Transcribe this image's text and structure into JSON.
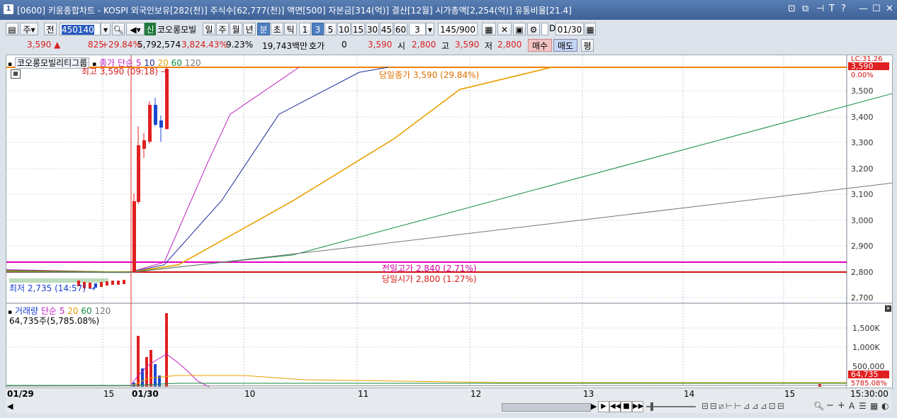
{
  "window": {
    "number": "1",
    "title": "[0600] 키움종합차트 - KOSPI 외국인보유[282(천)] 주식수[62,777(천)] 액면[500] 자본금[314(억)] 결산[12월] 시가총액[2,254(억)] 유통비율[21.4]"
  },
  "toolbar": {
    "market": "주",
    "prev": "전",
    "code": "450140",
    "sin_badge": "신",
    "stock_name": "코오롱모빌",
    "period_tabs": [
      "일",
      "주",
      "월",
      "년",
      "분",
      "초",
      "틱"
    ],
    "selected_period": "분",
    "interval_buttons": [
      "1",
      "3",
      "5",
      "10",
      "15",
      "30",
      "45",
      "60"
    ],
    "selected_interval": "3",
    "interval_value": "3",
    "count": "145",
    "count_max": "/900",
    "checkbox_label": "D",
    "date": "01/30"
  },
  "quote": {
    "price": "3,590",
    "change": "825",
    "change_pct": "+29.84%",
    "volume": "5,792,574",
    "volume_ratio": "3,824.43%",
    "turnover": "9.23%",
    "amount": "19,743백만",
    "hoga_label": "호가",
    "hoga_value": "0",
    "hoga_price": "3,590",
    "open_label": "시",
    "open": "2,800",
    "high_label": "고",
    "high": "3,590",
    "low_label": "저",
    "low": "2,800",
    "buy_label": "매수",
    "sell_label": "매도",
    "flat_label": "평"
  },
  "main_legend": {
    "name": "코오롱모빌리티그룹",
    "ma_label": "종가 단순",
    "periods": [
      "5",
      "10",
      "20",
      "60",
      "120"
    ],
    "period_colors": [
      "#c020c0",
      "#1a2a9a",
      "#e8a000",
      "#108a40",
      "#777777"
    ]
  },
  "annotations": {
    "high_marker": "최고 3,590 (09:18) →",
    "low_marker": "최저 2,735 (14:57) →",
    "today_close": "당일종가 3,590 (29.84%)",
    "prev_high": "전일고가 2,840 (2.71%)",
    "today_open": "당일시가 2,800 (1.27%)",
    "lc_label": "LC:31.26",
    "price_badge": "3,590",
    "pct_badge": "0.00%"
  },
  "price_axis": [
    "3,500",
    "3,400",
    "3,300",
    "3,200",
    "3,100",
    "3,000",
    "2,900",
    "2,800",
    "2,700"
  ],
  "volume_legend": {
    "label": "거래량",
    "ma_label": "단순",
    "periods": [
      "5",
      "20",
      "60",
      "120"
    ],
    "volume_value": "64,735주(5,785.08%)"
  },
  "volume_axis": [
    "1,500K",
    "1,000K",
    "500,000"
  ],
  "volume_badges": {
    "value": "64,735",
    "pct": "5785.08%"
  },
  "date_axis": {
    "labels": [
      "01/29",
      "15",
      "01/30",
      "10",
      "11",
      "12",
      "13",
      "14",
      "15"
    ],
    "time": "15:30:00"
  },
  "colors": {
    "candle_up": "#e02020",
    "candle_down": "#1a4ad0",
    "close_line": "#f08000",
    "prev_high_line": "#e800c0",
    "open_line": "#d01010"
  },
  "chart_data": {
    "type": "line",
    "ylim": [
      2700,
      3590
    ],
    "series": [
      {
        "name": "5",
        "color": "#c020c0",
        "points": [
          [
            0,
            2770
          ],
          [
            0.43,
            2760
          ],
          [
            0.55,
            2800
          ],
          [
            0.7,
            3200
          ],
          [
            0.78,
            3400
          ],
          [
            1.02,
            3590
          ]
        ]
      },
      {
        "name": "10",
        "color": "#1a2a9a",
        "points": [
          [
            0,
            2768
          ],
          [
            0.43,
            2760
          ],
          [
            0.55,
            2790
          ],
          [
            0.75,
            3050
          ],
          [
            0.95,
            3400
          ],
          [
            1.23,
            3570
          ],
          [
            1.33,
            3590
          ]
        ]
      },
      {
        "name": "20",
        "color": "#e8a000",
        "points": [
          [
            0,
            2765
          ],
          [
            0.43,
            2760
          ],
          [
            0.6,
            2790
          ],
          [
            1.0,
            3050
          ],
          [
            1.35,
            3300
          ],
          [
            1.58,
            3500
          ],
          [
            1.9,
            3590
          ]
        ]
      },
      {
        "name": "60",
        "color": "#108a40",
        "points": [
          [
            0,
            2762
          ],
          [
            0.43,
            2760
          ],
          [
            1.0,
            2830
          ],
          [
            2.5,
            3300
          ],
          [
            3.3,
            3550
          ],
          [
            3.7,
            3590
          ]
        ]
      },
      {
        "name": "120",
        "color": "#777777",
        "points": [
          [
            0,
            2760
          ],
          [
            0.43,
            2758
          ],
          [
            1.2,
            2860
          ],
          [
            5.9,
            3510
          ],
          [
            6.3,
            3590
          ]
        ]
      }
    ],
    "candles_x_range": [
      "01/29 14:57",
      "01/30 09:30"
    ]
  }
}
